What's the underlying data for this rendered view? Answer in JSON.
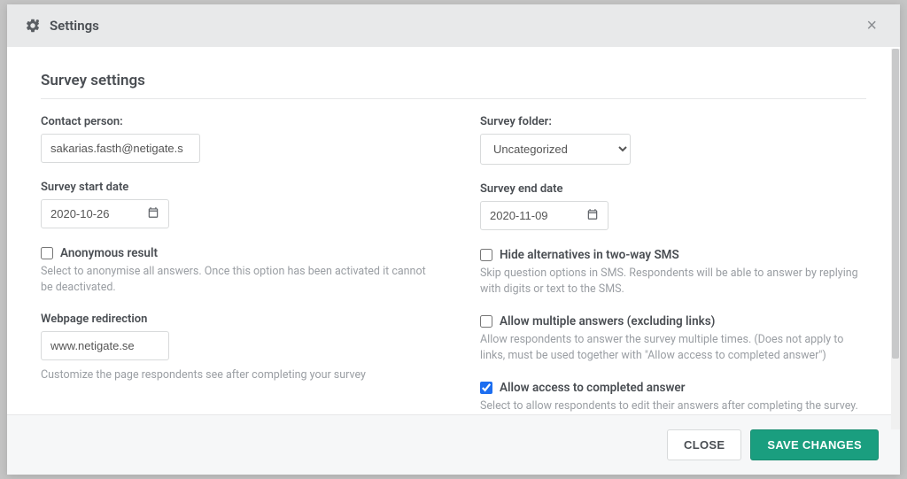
{
  "header": {
    "title": "Settings",
    "close": "×"
  },
  "section_title": "Survey settings",
  "left": {
    "contact_label": "Contact person:",
    "contact_value": "sakarias.fasth@netigate.s",
    "start_date_label": "Survey start date",
    "start_date_value": "2020-10-26",
    "anonymous": {
      "label": "Anonymous result",
      "help": "Select to anonymise all answers. Once this option has been activated it cannot be deactivated.",
      "checked": false
    },
    "redirect_label": "Webpage redirection",
    "redirect_value": "www.netigate.se",
    "redirect_help": "Customize the page respondents see after completing your survey"
  },
  "right": {
    "folder_label": "Survey folder:",
    "folder_value": "Uncategorized",
    "end_date_label": "Survey end date",
    "end_date_value": "2020-11-09",
    "hide_alt": {
      "label": "Hide alternatives in two-way SMS",
      "help": "Skip question options in SMS. Respondents will be able to answer by replying with digits or text to the SMS.",
      "checked": false
    },
    "multiple": {
      "label": "Allow multiple answers (excluding links)",
      "help": "Allow respondents to answer the survey multiple times. (Does not apply to links, must be used together with \"Allow access to completed answer\")",
      "checked": false
    },
    "access": {
      "label": "Allow access to completed answer",
      "help": "Select to allow respondents to edit their answers after completing the survey.",
      "checked": true
    }
  },
  "footer": {
    "close": "CLOSE",
    "save": "SAVE CHANGES"
  }
}
